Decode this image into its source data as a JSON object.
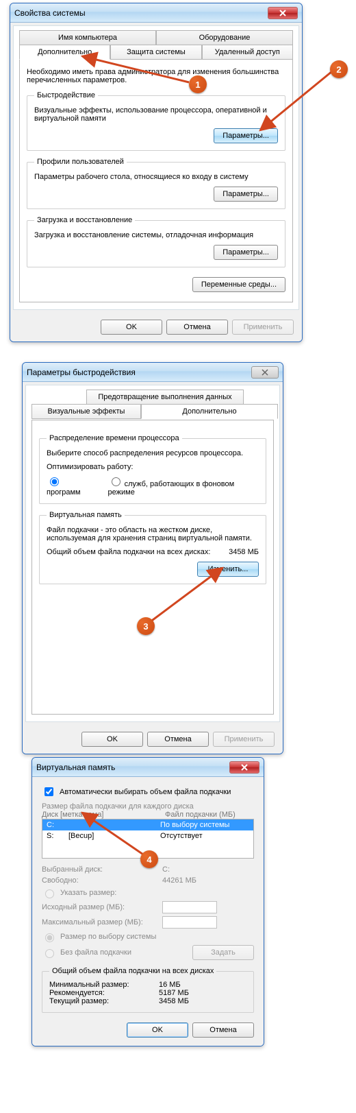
{
  "w1": {
    "title": "Свойства системы",
    "tabs_row1": [
      "Имя компьютера",
      "Оборудование"
    ],
    "tabs_row2": [
      "Дополнительно",
      "Защита системы",
      "Удаленный доступ"
    ],
    "intro": "Необходимо иметь права администратора для изменения большинства перечисленных параметров.",
    "g1": {
      "legend": "Быстродействие",
      "desc": "Визуальные эффекты, использование процессора, оперативной и виртуальной памяти",
      "btn": "Параметры..."
    },
    "g2": {
      "legend": "Профили пользователей",
      "desc": "Параметры рабочего стола, относящиеся ко входу в систему",
      "btn": "Параметры..."
    },
    "g3": {
      "legend": "Загрузка и восстановление",
      "desc": "Загрузка и восстановление системы, отладочная информация",
      "btn": "Параметры..."
    },
    "env_btn": "Переменные среды...",
    "ok": "OK",
    "cancel": "Отмена",
    "apply": "Применить"
  },
  "w2": {
    "title": "Параметры быстродействия",
    "tab_dep": "Предотвращение выполнения данных",
    "tab_vis": "Визуальные эффекты",
    "tab_adv": "Дополнительно",
    "proc": {
      "legend": "Распределение времени процессора",
      "desc": "Выберите способ распределения ресурсов процессора.",
      "opt_label": "Оптимизировать работу:",
      "r1": "программ",
      "r2": "служб, работающих в фоновом режиме"
    },
    "vm": {
      "legend": "Виртуальная память",
      "desc": "Файл подкачки - это область на жестком диске, используемая для хранения страниц виртуальной памяти.",
      "total_label": "Общий объем файла подкачки на всех дисках:",
      "total_val": "3458 МБ",
      "btn": "Изменить..."
    },
    "ok": "OK",
    "cancel": "Отмена",
    "apply": "Применить"
  },
  "w3": {
    "title": "Виртуальная память",
    "auto": "Автоматически выбирать объем файла подкачки",
    "heading": "Размер файла подкачки для каждого диска",
    "col1": "Диск [метка тома]",
    "col2": "Файл подкачки (МБ)",
    "rows": [
      {
        "d": "C:",
        "label": "",
        "val": "По выбору системы"
      },
      {
        "d": "S:",
        "label": "[Becup]",
        "val": "Отсутствует"
      }
    ],
    "sel_drive_lbl": "Выбранный диск:",
    "sel_drive": "C:",
    "free_lbl": "Свободно:",
    "free": "44261 МБ",
    "r_custom": "Указать размер:",
    "init_lbl": "Исходный размер (МБ):",
    "max_lbl": "Максимальный размер (МБ):",
    "r_sys": "Размер по выбору системы",
    "r_none": "Без файла подкачки",
    "set_btn": "Задать",
    "sum_legend": "Общий объем файла подкачки на всех дисках",
    "sum_min_l": "Минимальный размер:",
    "sum_min": "16 МБ",
    "sum_rec_l": "Рекомендуется:",
    "sum_rec": "5187 МБ",
    "sum_cur_l": "Текущий размер:",
    "sum_cur": "3458 МБ",
    "ok": "OK",
    "cancel": "Отмена"
  },
  "badges": {
    "b1": "1",
    "b2": "2",
    "b3": "3",
    "b4": "4"
  }
}
